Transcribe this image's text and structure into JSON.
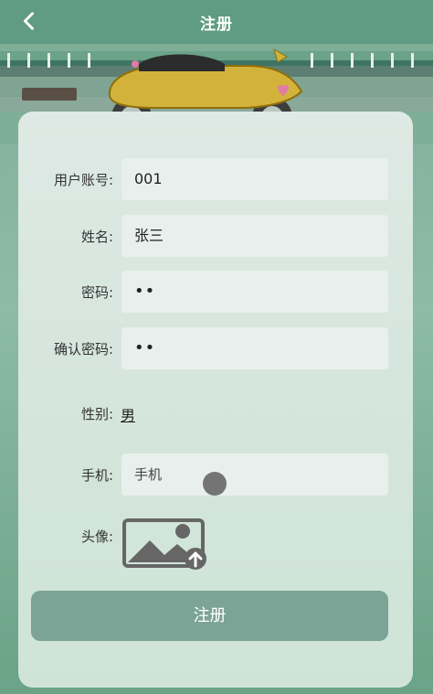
{
  "header": {
    "title": "注册",
    "back_icon": "chevron-left-icon"
  },
  "form": {
    "fields": [
      {
        "label": "用户账号:",
        "value": "001"
      },
      {
        "label": "姓名:",
        "value": "张三"
      },
      {
        "label": "密码:",
        "value": "••"
      },
      {
        "label": "确认密码:",
        "value": "••"
      },
      {
        "label": "性别:",
        "value": "男"
      },
      {
        "label": "手机:",
        "value": "手机"
      },
      {
        "label": "头像:",
        "value": ""
      }
    ],
    "submit_label": "注册"
  }
}
